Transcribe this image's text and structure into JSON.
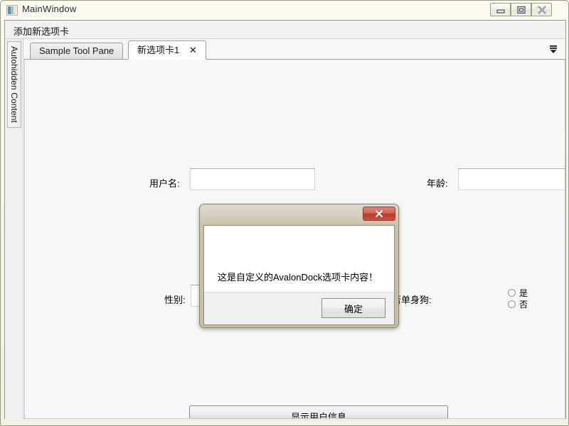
{
  "window": {
    "title": "MainWindow",
    "icon": "application-window-icon",
    "controls": {
      "minimize_label": "Minimize",
      "maximize_label": "Maximize",
      "close_label": "Close"
    }
  },
  "menubar": {
    "items": [
      {
        "label": "添加新选项卡"
      }
    ]
  },
  "autohide_panel": {
    "label": "Autohidden Content"
  },
  "dock": {
    "tabs": [
      {
        "label": "Sample Tool Pane",
        "active": false,
        "closable": false
      },
      {
        "label": "新选项卡1",
        "active": true,
        "closable": true,
        "close_glyph": "✕"
      }
    ],
    "overflow_menu_icon": "tab-list-dropdown-icon"
  },
  "form": {
    "username": {
      "label": "用户名:",
      "value": "",
      "placeholder": ""
    },
    "age": {
      "label": "年龄:",
      "value": "",
      "placeholder": ""
    },
    "gender": {
      "label": "性别:",
      "value": "",
      "placeholder": ""
    },
    "single": {
      "label": "是否单身狗:",
      "options": [
        {
          "label": "是",
          "selected": false
        },
        {
          "label": "否",
          "selected": false
        }
      ]
    },
    "submit_label": "显示用户信息"
  },
  "dialog": {
    "message": "这是自定义的AvalonDock选项卡内容！",
    "ok_label": "确定",
    "close_label": "Close",
    "close_button_color": "#bf3f2a",
    "frame_color": "#c8bda0"
  },
  "colors": {
    "client_background": "#f7f7f7",
    "titlebar_background": "#f7f6ea",
    "tab_active_background": "#ffffff",
    "tab_inactive_background": "#e8e8e8",
    "border": "#9a9a9a"
  }
}
